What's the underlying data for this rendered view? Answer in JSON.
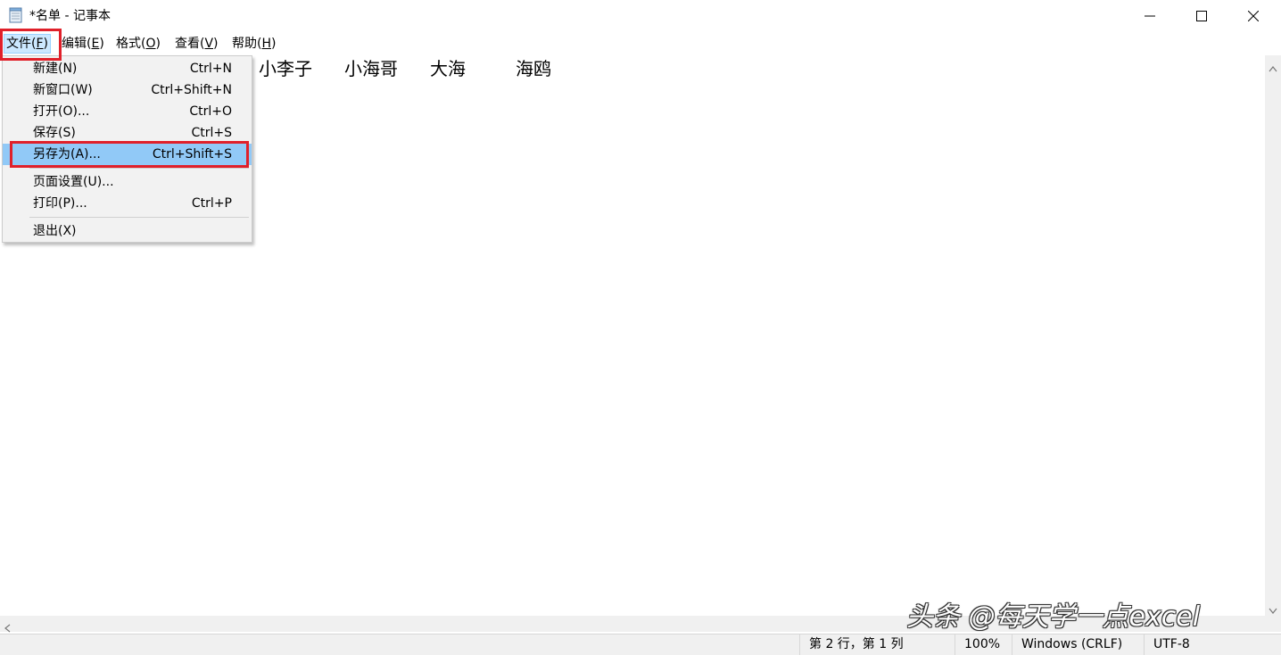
{
  "window": {
    "title": "*名单 - 记事本",
    "icons": {
      "app": "notepad-icon",
      "minimize": "minimize-icon",
      "maximize": "maximize-icon",
      "close": "close-icon"
    }
  },
  "menubar": {
    "items": [
      {
        "label": "文件(",
        "key": "F",
        "suffix": ")"
      },
      {
        "label": "编辑(",
        "key": "E",
        "suffix": ")"
      },
      {
        "label": "格式(",
        "key": "O",
        "suffix": ")"
      },
      {
        "label": "查看(",
        "key": "V",
        "suffix": ")"
      },
      {
        "label": "帮助(",
        "key": "H",
        "suffix": ")"
      }
    ]
  },
  "file_menu": {
    "items": [
      {
        "label": "新建(N)",
        "shortcut": "Ctrl+N"
      },
      {
        "label": "新窗口(W)",
        "shortcut": "Ctrl+Shift+N"
      },
      {
        "label": "打开(O)...",
        "shortcut": "Ctrl+O"
      },
      {
        "label": "保存(S)",
        "shortcut": "Ctrl+S"
      },
      {
        "label": "另存为(A)...",
        "shortcut": "Ctrl+Shift+S"
      },
      {
        "label": "页面设置(U)...",
        "shortcut": ""
      },
      {
        "label": "打印(P)...",
        "shortcut": "Ctrl+P"
      },
      {
        "label": "退出(X)",
        "shortcut": ""
      }
    ],
    "selected_index": 4
  },
  "editor": {
    "visible_names": [
      "小李子",
      "小海哥",
      "大海",
      "海鸥"
    ]
  },
  "statusbar": {
    "position": "第 2 行，第 1 列",
    "zoom": "100%",
    "line_ending": "Windows (CRLF)",
    "encoding": "UTF-8"
  },
  "watermark": "头条 @每天学一点excel",
  "colors": {
    "highlight_red": "#e0202a",
    "menu_selected": "#91c9f7"
  }
}
